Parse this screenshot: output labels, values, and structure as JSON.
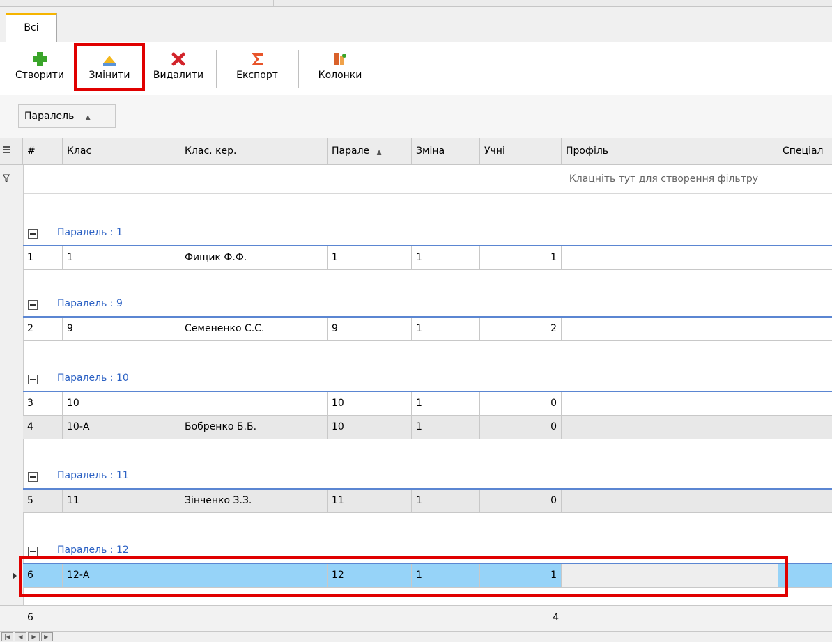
{
  "tabs": [
    {
      "label": "Всі"
    }
  ],
  "toolbar": {
    "create": "Створити",
    "edit": "Змінити",
    "delete": "Видалити",
    "export": "Експорт",
    "columns": "Колонки"
  },
  "group_panel": {
    "chip": "Паралель",
    "sort": "▲"
  },
  "columns": [
    "#",
    "Клас",
    "Клас. кер.",
    "Парале",
    "Зміна",
    "Учні",
    "Профіль",
    "Спеціал"
  ],
  "sort_indicator": "▲",
  "filter_prompt": "Клацніть тут для створення фільтру",
  "groups": [
    {
      "label": "Паралель : 1",
      "rows": [
        {
          "n": "1",
          "klas": "1",
          "ker": "Фищик Ф.Ф.",
          "par": "1",
          "zmina": "1",
          "uchni": "1"
        }
      ]
    },
    {
      "label": "Паралель : 9",
      "rows": [
        {
          "n": "2",
          "klas": "9",
          "ker": "Семененко С.С.",
          "par": "9",
          "zmina": "1",
          "uchni": "2"
        }
      ]
    },
    {
      "label": "Паралель : 10",
      "rows": [
        {
          "n": "3",
          "klas": "10",
          "ker": "",
          "par": "10",
          "zmina": "1",
          "uchni": "0"
        },
        {
          "n": "4",
          "klas": "10-А",
          "ker": "Бобренко Б.Б.",
          "par": "10",
          "zmina": "1",
          "uchni": "0"
        }
      ]
    },
    {
      "label": "Паралель : 11",
      "rows": [
        {
          "n": "5",
          "klas": "11",
          "ker": "Зінченко З.З.",
          "par": "11",
          "zmina": "1",
          "uchni": "0"
        }
      ]
    },
    {
      "label": "Паралель : 12",
      "rows": [
        {
          "n": "6",
          "klas": "12-А",
          "ker": "",
          "par": "12",
          "zmina": "1",
          "uchni": "1"
        }
      ]
    }
  ],
  "footer": {
    "count": "6",
    "students_total": "4"
  },
  "colors": {
    "selected_row": "#96d3f8",
    "group_line": "#5b86d2",
    "highlight": "#e00000"
  }
}
